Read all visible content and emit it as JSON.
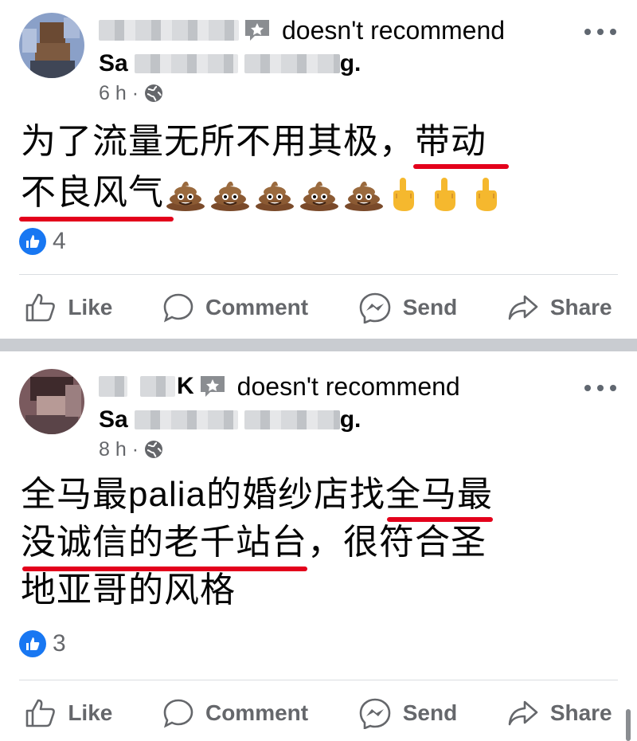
{
  "posts": [
    {
      "name_visible": "",
      "recommend_text": "doesn't recommend",
      "page_suffix": "g.",
      "page_prefix": "Sa",
      "time": "6 h ·",
      "text_line1_pre": "为了流量无所不用其极，",
      "text_line1_under": "带动",
      "text_line2_under": "不良风气",
      "like_count": "4"
    },
    {
      "name_visible": "K",
      "recommend_text": "doesn't recommend",
      "page_suffix": "g.",
      "page_prefix": "Sa",
      "time": "8 h ·",
      "text_line1_pre": "全马最palia的婚纱店找",
      "text_line1_under": "全马最",
      "text_line2_under": "没诚信的老千站台",
      "text_line2_post": "，很符合圣",
      "text_line3": "地亚哥的风格",
      "like_count": "3"
    }
  ],
  "actions": {
    "like": "Like",
    "comment": "Comment",
    "send": "Send",
    "share": "Share"
  },
  "colors": {
    "like_blue": "#1877f2",
    "underline_red": "#e3001b",
    "secondary_text": "#65676b"
  }
}
